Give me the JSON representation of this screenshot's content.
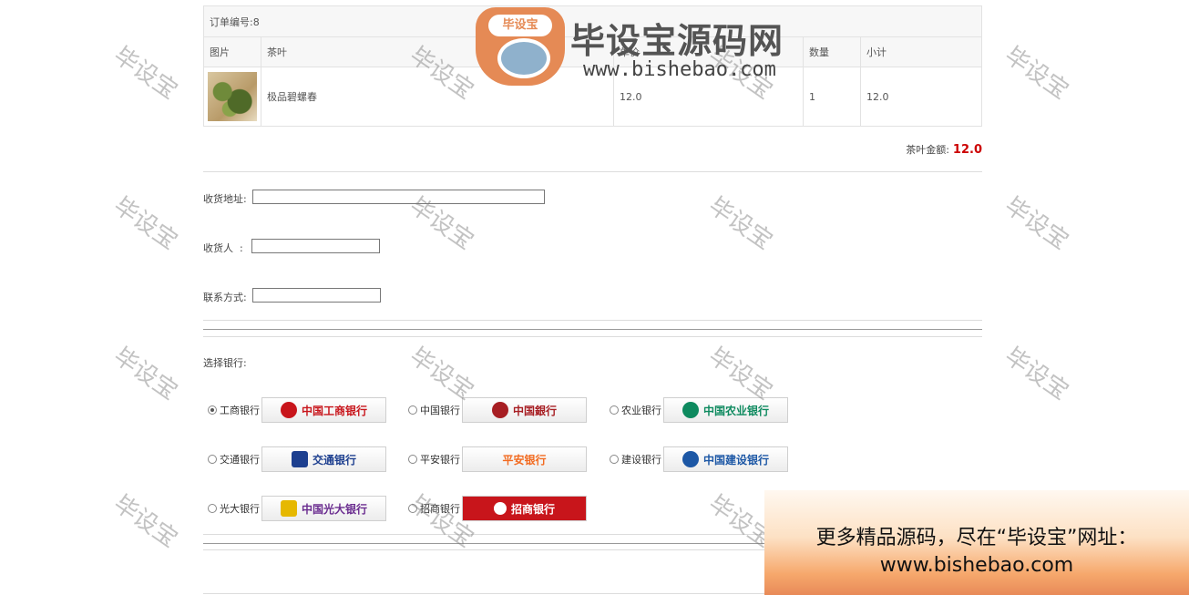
{
  "order": {
    "title": "订单编号:8",
    "headers": [
      "图片",
      "茶叶",
      "单价",
      "数量",
      "小计"
    ],
    "item": {
      "name": "极品碧螺春",
      "price": "12.0",
      "qty": "1",
      "subtotal": "12.0"
    },
    "total_label": "茶叶金额:",
    "total_value": "12.0"
  },
  "form": {
    "address_label": "收货地址:",
    "receiver_label": "收货人  :",
    "contact_label": "联系方式:",
    "address_value": "",
    "receiver_value": "",
    "contact_value": ""
  },
  "banks": {
    "heading": "选择银行:",
    "items": [
      {
        "name": "工商银行",
        "logo": "中国工商银行",
        "selected": true,
        "color": "#c8151b"
      },
      {
        "name": "中国银行",
        "logo": "中国銀行",
        "selected": false,
        "color": "#a71e23"
      },
      {
        "name": "农业银行",
        "logo": "中国农业银行",
        "selected": false,
        "color": "#0e8a5f"
      },
      {
        "name": "交通银行",
        "logo": "交通银行",
        "selected": false,
        "color": "#1d3f8f"
      },
      {
        "name": "平安银行",
        "logo": "平安银行",
        "selected": false,
        "color": "#f26b21"
      },
      {
        "name": "建设银行",
        "logo": "中国建设银行",
        "selected": false,
        "color": "#1c57a5"
      },
      {
        "name": "光大银行",
        "logo": "中国光大银行",
        "selected": false,
        "color": "#6a2c8f"
      },
      {
        "name": "招商银行",
        "logo": "招商银行",
        "selected": false,
        "color": "#c8151b"
      }
    ]
  },
  "watermark": "毕设宝",
  "brand": {
    "title": "毕设宝源码网",
    "url": "www.bishebao.com",
    "tag": "毕设宝"
  },
  "ad": {
    "line1": "更多精品源码，尽在“毕设宝”网址：",
    "line2": "www.bishebao.com"
  }
}
